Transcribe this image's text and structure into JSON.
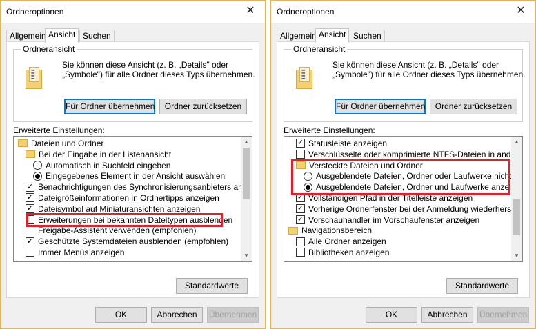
{
  "left": {
    "title": "Ordneroptionen",
    "close": "✕",
    "tabs": [
      "Allgemein",
      "Ansicht",
      "Suchen"
    ],
    "group": {
      "title": "Ordneransicht",
      "line1": "Sie können diese Ansicht (z. B. „Details\" oder",
      "line2": "„Symbole\") für alle Ordner dieses Typs übernehmen.",
      "apply": "Für Ordner übernehmen",
      "reset": "Ordner zurücksetzen"
    },
    "advanced_label": "Erweiterte Einstellungen:",
    "items": [
      {
        "type": "folder",
        "indent": 0,
        "label": "Dateien und Ordner"
      },
      {
        "type": "folder",
        "indent": 1,
        "label": "Bei der Eingabe in der Listenansicht"
      },
      {
        "type": "radio",
        "checked": false,
        "indent": 2,
        "label": "Automatisch in Suchfeld eingeben"
      },
      {
        "type": "radio",
        "checked": true,
        "indent": 2,
        "label": "Eingegebenes Element in der Ansicht auswählen"
      },
      {
        "type": "checkbox",
        "checked": true,
        "indent": 1,
        "label": "Benachrichtigungen des Synchronisierungsanbieters anzeigen"
      },
      {
        "type": "checkbox",
        "checked": true,
        "indent": 1,
        "label": "Dateigrößeinformationen in Ordnertipps anzeigen"
      },
      {
        "type": "checkbox",
        "checked": true,
        "indent": 1,
        "label": "Dateisymbol auf Miniaturansichten anzeigen"
      },
      {
        "type": "checkbox",
        "checked": false,
        "indent": 1,
        "label": "Erweiterungen bei bekannten Dateitypen ausblenden"
      },
      {
        "type": "checkbox",
        "checked": false,
        "indent": 1,
        "label": "Freigabe-Assistent verwenden (empfohlen)"
      },
      {
        "type": "checkbox",
        "checked": true,
        "indent": 1,
        "label": "Geschützte Systemdateien ausblenden (empfohlen)"
      },
      {
        "type": "checkbox",
        "checked": false,
        "indent": 1,
        "label": "Immer Menüs anzeigen"
      }
    ],
    "scroll": {
      "thumb_start": 0.0,
      "thumb_end": 0.5
    },
    "defaults": "Standardwerte",
    "ok": "OK",
    "cancel": "Abbrechen",
    "apply_btn": "Übernehmen"
  },
  "right": {
    "title": "Ordneroptionen",
    "close": "✕",
    "tabs": [
      "Allgemein",
      "Ansicht",
      "Suchen"
    ],
    "group": {
      "title": "Ordneransicht",
      "line1": "Sie können diese Ansicht (z. B. „Details\" oder",
      "line2": "„Symbole\") für alle Ordner dieses Typs übernehmen.",
      "apply": "Für Ordner übernehmen",
      "reset": "Ordner zurücksetzen"
    },
    "advanced_label": "Erweiterte Einstellungen:",
    "items": [
      {
        "type": "checkbox",
        "checked": true,
        "indent": 1,
        "label": "Statusleiste anzeigen"
      },
      {
        "type": "checkbox",
        "checked": false,
        "indent": 1,
        "label": "Verschlüsselte oder komprimierte NTFS-Dateien in anderer Farbe anzeigen"
      },
      {
        "type": "folder",
        "indent": 1,
        "label": "Versteckte Dateien und Ordner"
      },
      {
        "type": "radio",
        "checked": false,
        "indent": 2,
        "label": "Ausgeblendete Dateien, Ordner oder Laufwerke nicht anzeigen"
      },
      {
        "type": "radio",
        "checked": true,
        "indent": 2,
        "label": "Ausgeblendete Dateien, Ordner und Laufwerke anzeigen"
      },
      {
        "type": "checkbox",
        "checked": true,
        "indent": 1,
        "label": "Vollständigen Pfad in der Titelleiste anzeigen"
      },
      {
        "type": "checkbox",
        "checked": true,
        "indent": 1,
        "label": "Vorherige Ordnerfenster bei der Anmeldung wiederherstellen"
      },
      {
        "type": "checkbox",
        "checked": true,
        "indent": 1,
        "label": "Vorschauhandler im Vorschaufenster anzeigen"
      },
      {
        "type": "folder",
        "indent": 0,
        "label": "Navigationsbereich"
      },
      {
        "type": "checkbox",
        "checked": false,
        "indent": 1,
        "label": "Alle Ordner anzeigen"
      },
      {
        "type": "checkbox",
        "checked": false,
        "indent": 1,
        "label": "Bibliotheken anzeigen"
      }
    ],
    "scroll": {
      "thumb_start": 0.5,
      "thumb_end": 0.85
    },
    "defaults": "Standardwerte",
    "ok": "OK",
    "cancel": "Abbrechen",
    "apply_btn": "Übernehmen"
  }
}
